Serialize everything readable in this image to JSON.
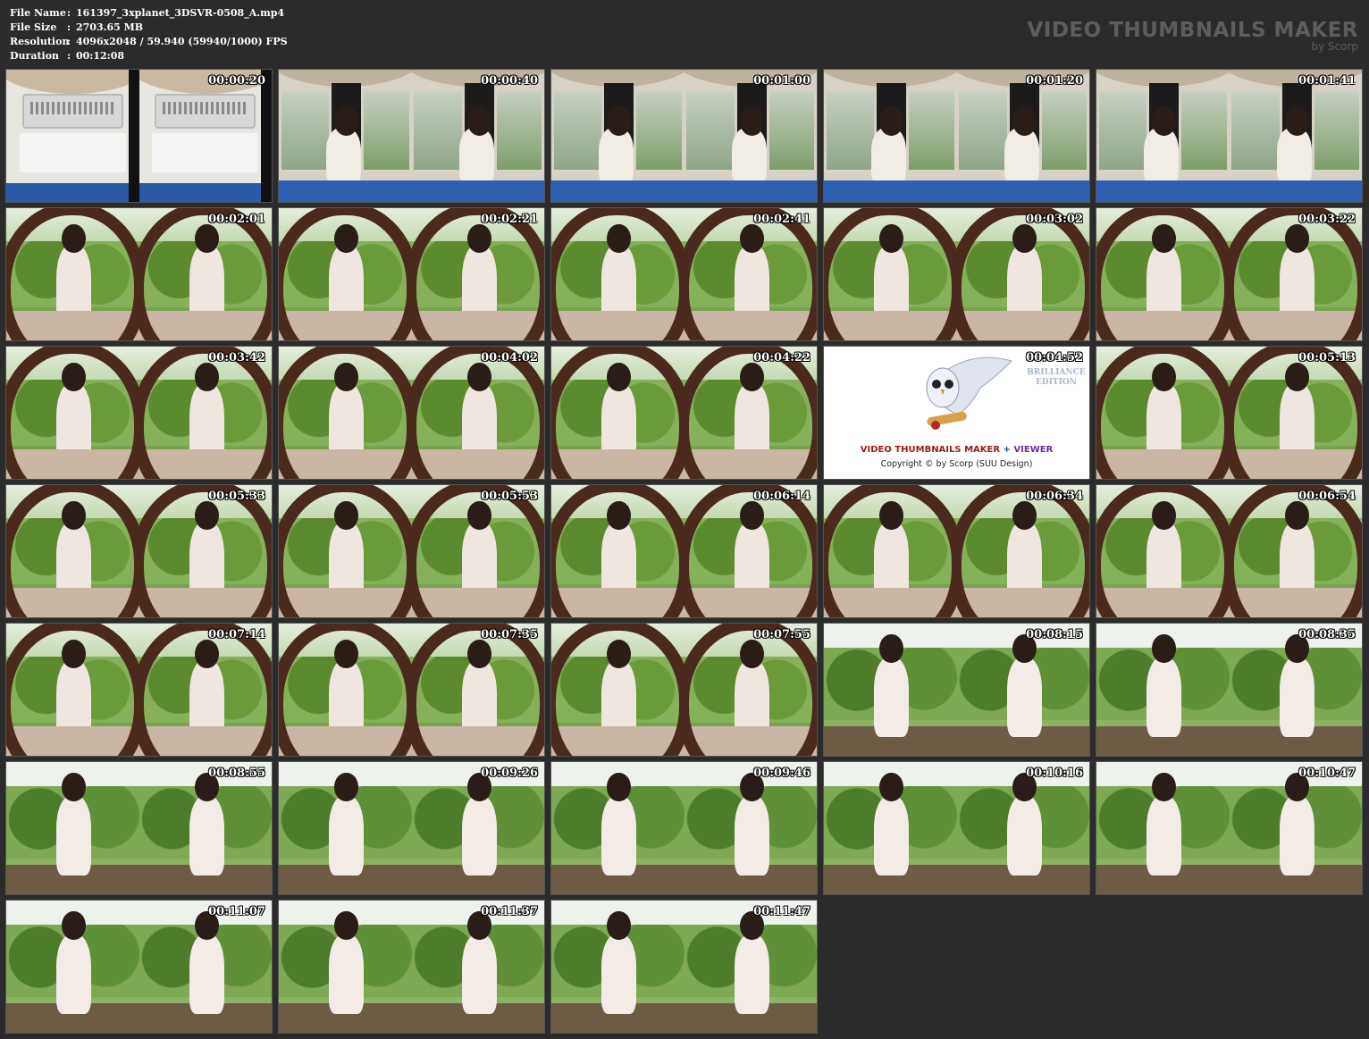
{
  "info": {
    "rows": [
      {
        "label": "File Name",
        "sep": ":",
        "value": "161397_3xplanet_3DSVR-0508_A.mp4"
      },
      {
        "label": "File Size",
        "sep": ":",
        "value": "2703.65 MB"
      },
      {
        "label": "Resolution",
        "sep": ":",
        "value": "4096x2048 / 59.940 (59940/1000) FPS"
      },
      {
        "label": "Duration",
        "sep": ":",
        "value": "00:12:08"
      }
    ]
  },
  "brand": {
    "title": "VIDEO THUMBNAILS MAKER",
    "subtitle": "by Scorp"
  },
  "thumbnails": [
    {
      "time": "00:00:20",
      "scene": "ac"
    },
    {
      "time": "00:00:40",
      "scene": "room"
    },
    {
      "time": "00:01:00",
      "scene": "room"
    },
    {
      "time": "00:01:20",
      "scene": "room"
    },
    {
      "time": "00:01:41",
      "scene": "room"
    },
    {
      "time": "00:02:01",
      "scene": "window"
    },
    {
      "time": "00:02:21",
      "scene": "window"
    },
    {
      "time": "00:02:41",
      "scene": "window"
    },
    {
      "time": "00:03:02",
      "scene": "window"
    },
    {
      "time": "00:03:22",
      "scene": "window"
    },
    {
      "time": "00:03:42",
      "scene": "window"
    },
    {
      "time": "00:04:02",
      "scene": "window"
    },
    {
      "time": "00:04:22",
      "scene": "window"
    },
    {
      "time": "00:04:52",
      "scene": "ad"
    },
    {
      "time": "00:05:13",
      "scene": "window"
    },
    {
      "time": "00:05:33",
      "scene": "window"
    },
    {
      "time": "00:05:53",
      "scene": "window"
    },
    {
      "time": "00:06:14",
      "scene": "window"
    },
    {
      "time": "00:06:34",
      "scene": "window"
    },
    {
      "time": "00:06:54",
      "scene": "window"
    },
    {
      "time": "00:07:14",
      "scene": "window"
    },
    {
      "time": "00:07:35",
      "scene": "window"
    },
    {
      "time": "00:07:55",
      "scene": "window"
    },
    {
      "time": "00:08:15",
      "scene": "garden"
    },
    {
      "time": "00:08:35",
      "scene": "garden"
    },
    {
      "time": "00:08:55",
      "scene": "garden"
    },
    {
      "time": "00:09:26",
      "scene": "garden"
    },
    {
      "time": "00:09:46",
      "scene": "garden"
    },
    {
      "time": "00:10:16",
      "scene": "garden"
    },
    {
      "time": "00:10:47",
      "scene": "garden"
    },
    {
      "time": "00:11:07",
      "scene": "garden"
    },
    {
      "time": "00:11:37",
      "scene": "garden"
    },
    {
      "time": "00:11:47",
      "scene": "garden"
    }
  ],
  "ad": {
    "title_a": "VIDEO THUMBNAILS MAKER",
    "title_plus": " + ",
    "title_b": "VIEWER",
    "copyright": "Copyright © by Scorp (SUU Design)",
    "edition": "BRILLIANCE EDITION"
  },
  "colors": {
    "background": "#2b2b2b",
    "text": "#ffffff",
    "brand": "#5d5d5d"
  }
}
